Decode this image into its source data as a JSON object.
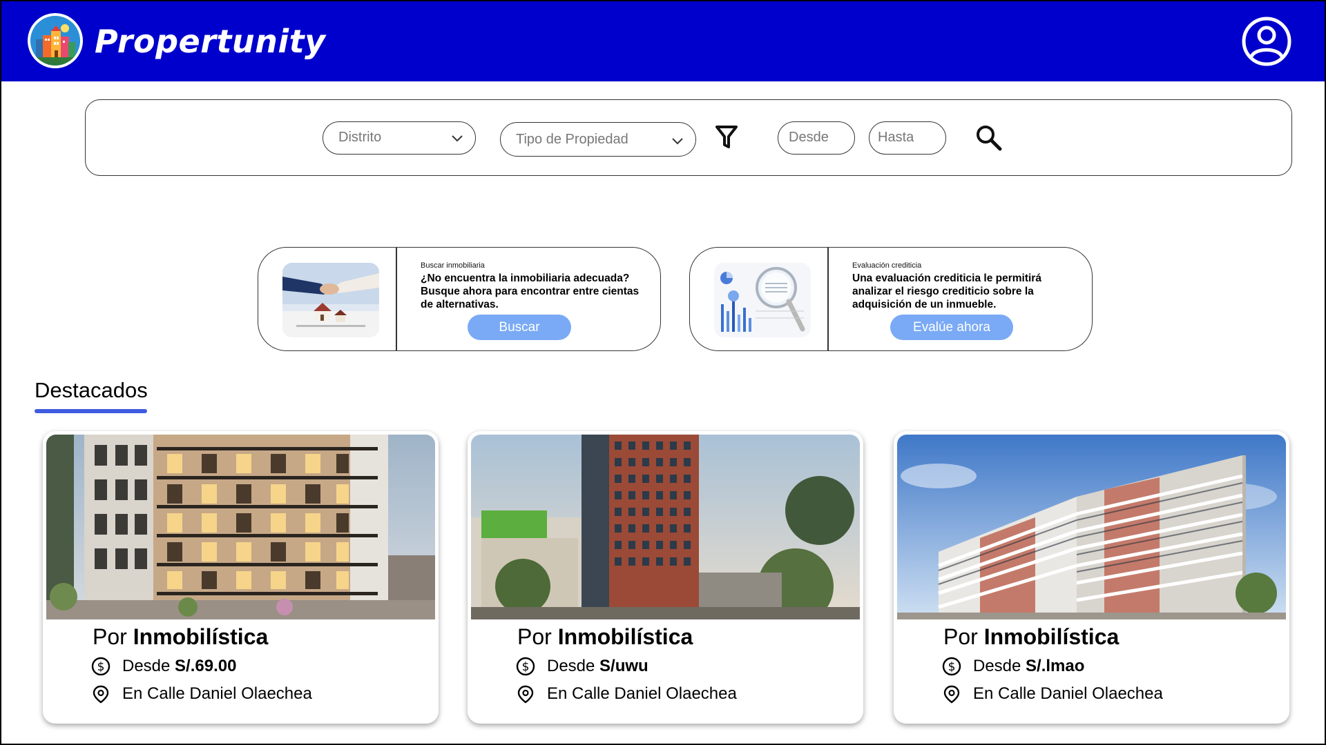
{
  "header": {
    "brand": "Propertunity",
    "colors": {
      "header_bg": "#0000cc",
      "accent": "#3f5be0",
      "cta": "#7aaaf5"
    }
  },
  "search": {
    "distrito_placeholder": "Distrito",
    "tipo_placeholder": "Tipo de Propiedad",
    "desde_placeholder": "Desde",
    "hasta_placeholder": "Hasta"
  },
  "promos": [
    {
      "kicker": "Buscar inmobiliaria",
      "description": "¿No encuentra la inmobiliaria adecuada? Busque ahora para encontrar entre cientas de alternativas.",
      "cta": "Buscar"
    },
    {
      "kicker": "Evaluación crediticia",
      "description": "Una evaluación crediticia le permitirá analizar el riesgo crediticio sobre la adquisición de un inmueble.",
      "cta": "Evalúe ahora"
    }
  ],
  "featured": {
    "title": "Destacados",
    "by_prefix": "Por",
    "price_prefix": "Desde",
    "address_prefix": "En",
    "cards": [
      {
        "company": "Inmobilística",
        "price": "S/.69.00",
        "address": "Calle Daniel Olaechea"
      },
      {
        "company": "Inmobilística",
        "price": "S/uwu",
        "address": "Calle Daniel Olaechea"
      },
      {
        "company": "Inmobilística",
        "price": "S/.lmao",
        "address": "Calle Daniel Olaechea"
      }
    ]
  },
  "icons": {
    "logo": "city-logo-icon",
    "user": "user-circle-icon",
    "filter": "filter-icon",
    "search": "search-icon",
    "dropdown": "chevron-down-icon",
    "price": "dollar-circle-icon",
    "location": "location-pin-icon"
  }
}
